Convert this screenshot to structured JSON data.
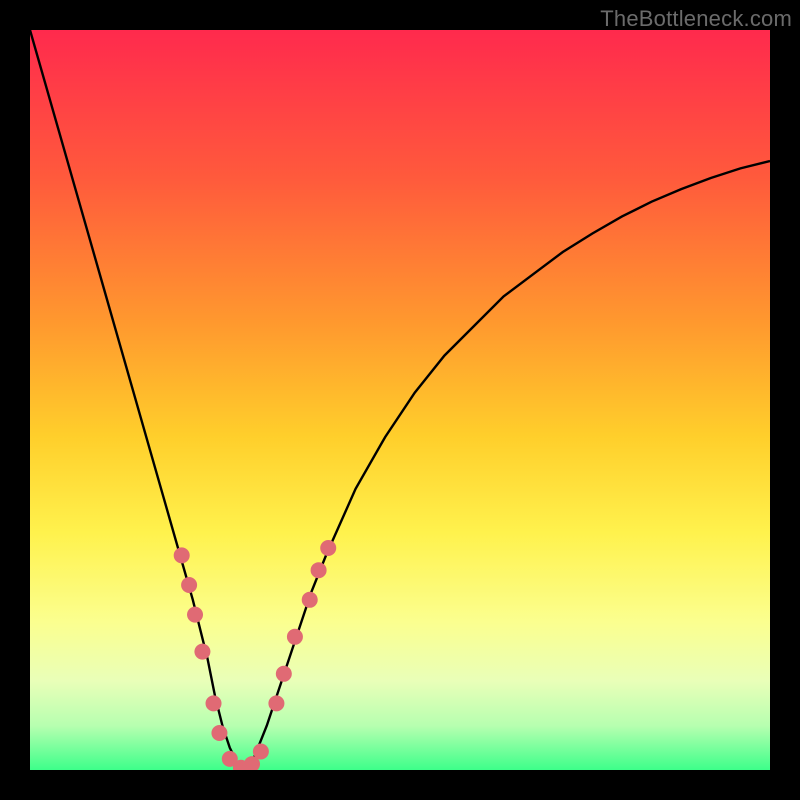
{
  "watermark": "TheBottleneck.com",
  "chart_data": {
    "type": "line",
    "title": "",
    "xlabel": "",
    "ylabel": "",
    "xlim": [
      0,
      100
    ],
    "ylim": [
      0,
      100
    ],
    "grid": false,
    "legend": false,
    "background_gradient": {
      "stops": [
        {
          "offset": 0.0,
          "color": "#ff2a4d"
        },
        {
          "offset": 0.2,
          "color": "#ff5a3c"
        },
        {
          "offset": 0.4,
          "color": "#ff9a2e"
        },
        {
          "offset": 0.55,
          "color": "#ffcf2b"
        },
        {
          "offset": 0.68,
          "color": "#fff24d"
        },
        {
          "offset": 0.8,
          "color": "#fbff8f"
        },
        {
          "offset": 0.88,
          "color": "#e9ffb8"
        },
        {
          "offset": 0.94,
          "color": "#b7ffb0"
        },
        {
          "offset": 1.0,
          "color": "#3dff8a"
        }
      ]
    },
    "series": [
      {
        "name": "curve",
        "color": "#000000",
        "x": [
          0,
          2,
          4,
          6,
          8,
          10,
          12,
          14,
          16,
          18,
          20,
          22,
          24,
          25,
          26,
          27,
          28,
          29,
          30,
          32,
          34,
          36,
          38,
          40,
          44,
          48,
          52,
          56,
          60,
          64,
          68,
          72,
          76,
          80,
          84,
          88,
          92,
          96,
          100
        ],
        "y": [
          100,
          93,
          86,
          79,
          72,
          65,
          58,
          51,
          44,
          37,
          30,
          23,
          15,
          10,
          6,
          3,
          1,
          0.3,
          1,
          6,
          12,
          18,
          24,
          29,
          38,
          45,
          51,
          56,
          60,
          64,
          67,
          70,
          72.5,
          74.8,
          76.8,
          78.5,
          80,
          81.3,
          82.3
        ]
      }
    ],
    "markers": {
      "color": "#e06a74",
      "radius_px": 8,
      "points": [
        {
          "x": 20.5,
          "y": 29
        },
        {
          "x": 21.5,
          "y": 25
        },
        {
          "x": 22.3,
          "y": 21
        },
        {
          "x": 23.3,
          "y": 16
        },
        {
          "x": 24.8,
          "y": 9
        },
        {
          "x": 25.6,
          "y": 5
        },
        {
          "x": 27.0,
          "y": 1.5
        },
        {
          "x": 28.5,
          "y": 0.3
        },
        {
          "x": 30.0,
          "y": 0.8
        },
        {
          "x": 31.2,
          "y": 2.5
        },
        {
          "x": 33.3,
          "y": 9
        },
        {
          "x": 34.3,
          "y": 13
        },
        {
          "x": 35.8,
          "y": 18
        },
        {
          "x": 37.8,
          "y": 23
        },
        {
          "x": 39.0,
          "y": 27
        },
        {
          "x": 40.3,
          "y": 30
        }
      ]
    }
  }
}
